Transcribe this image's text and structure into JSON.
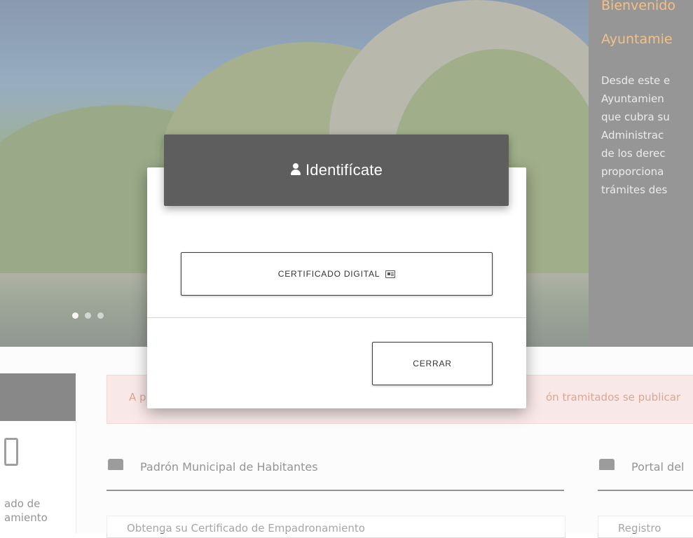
{
  "hero": {
    "carousel_dots": 3,
    "active_dot": 0
  },
  "welcome": {
    "title_line1": "Bienvenido",
    "title_line2": "Ayuntamie",
    "text": "Desde este e\nAyuntamien\nque cubra su\nAdministrac\nde los derec\nproporciona\ntrámites des"
  },
  "sidebar": {
    "label": "ado de\namiento"
  },
  "alert": {
    "text_left": "A p",
    "text_right": "ón tramitados se publicar"
  },
  "sections": [
    {
      "title": "Padrón Municipal de Habitantes",
      "first_item": "Obtenga su Certificado de Empadronamiento"
    },
    {
      "title": "Portal del",
      "first_item": "Registro"
    }
  ],
  "modal": {
    "title": "Identifícate",
    "cert_button": "CERTIFICADO DIGITAL",
    "close_button": "CERRAR",
    "colors": {
      "header_bg": "#5e5e5e",
      "accent": "#e98a17"
    }
  }
}
